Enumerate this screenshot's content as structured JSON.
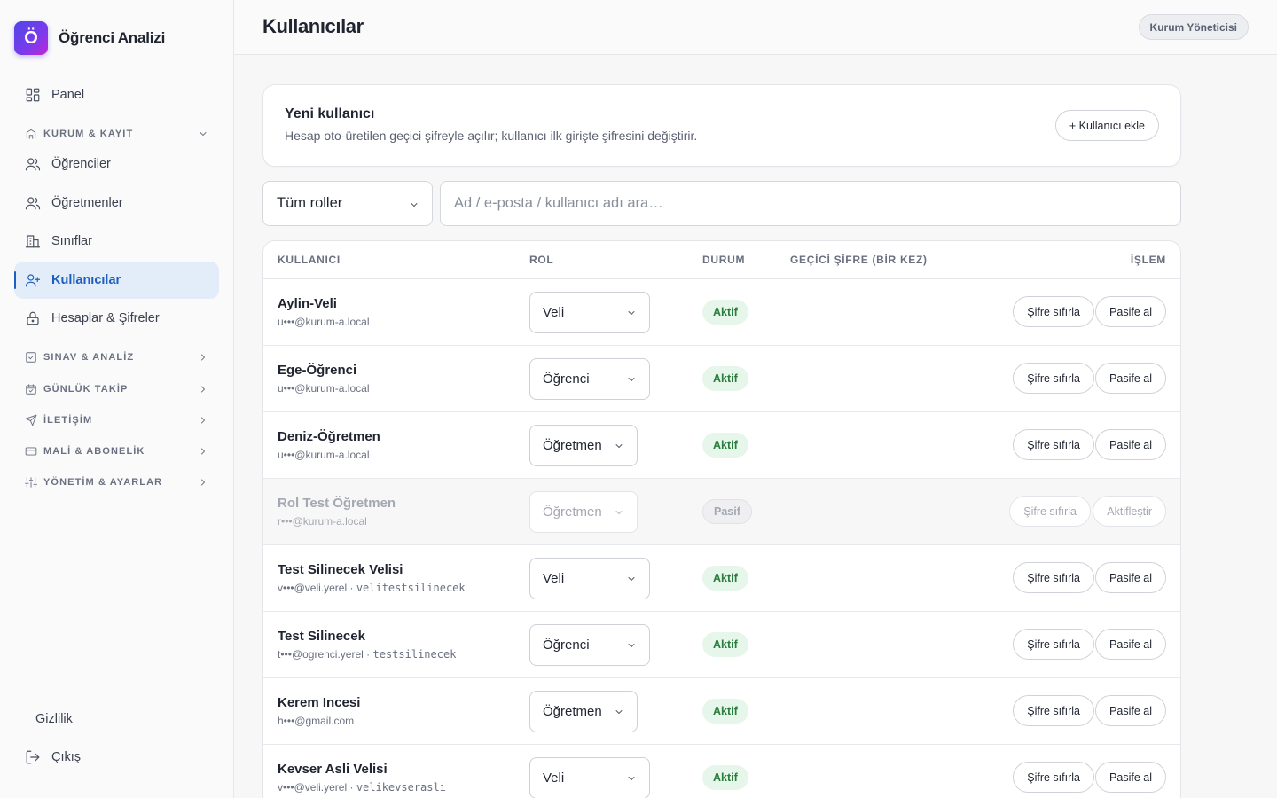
{
  "brand": {
    "logo_letter": "Ö",
    "title": "Öğrenci Analizi"
  },
  "sidebar": {
    "panel": "Panel",
    "groups": {
      "kurum": "KURUM & KAYIT",
      "sinav": "SINAV & ANALİZ",
      "gunluk": "GÜNLÜK TAKİP",
      "iletisim": "İLETİŞİM",
      "mali": "MALİ & ABONELİK",
      "yonetim": "YÖNETİM & AYARLAR"
    },
    "items": {
      "ogrenciler": "Öğrenciler",
      "ogretmenler": "Öğretmenler",
      "siniflar": "Sınıflar",
      "kullanicilar": "Kullanıcılar",
      "hesaplar": "Hesaplar & Şifreler"
    },
    "privacy": "Gizlilik",
    "logout": "Çıkış"
  },
  "header": {
    "title": "Kullanıcılar",
    "role_badge": "Kurum Yöneticisi"
  },
  "new_user": {
    "title": "Yeni kullanıcı",
    "subtitle": "Hesap oto-üretilen geçici şifreyle açılır; kullanıcı ilk girişte şifresini değiştirir.",
    "add_button": "+ Kullanıcı ekle"
  },
  "filters": {
    "role_select": "Tüm roller",
    "search_placeholder": "Ad / e-posta / kullanıcı adı ara…"
  },
  "table": {
    "headers": {
      "user": "KULLANICI",
      "role": "ROL",
      "status": "DURUM",
      "temp_password": "GEÇİCİ ŞİFRE (BİR KEZ)",
      "action": "İŞLEM"
    },
    "rows": [
      {
        "name": "Aylin-Veli",
        "email": "u•••@kurum-a.local",
        "username": "",
        "role": "Veli",
        "status": "Aktif",
        "reset": "Şifre sıfırla",
        "toggle": "Pasife al"
      },
      {
        "name": "Ege-Öğrenci",
        "email": "u•••@kurum-a.local",
        "username": "",
        "role": "Öğrenci",
        "status": "Aktif",
        "reset": "Şifre sıfırla",
        "toggle": "Pasife al"
      },
      {
        "name": "Deniz-Öğretmen",
        "email": "u•••@kurum-a.local",
        "username": "",
        "role": "Öğretmen",
        "status": "Aktif",
        "reset": "Şifre sıfırla",
        "toggle": "Pasife al"
      },
      {
        "name": "Rol Test Öğretmen",
        "email": "r•••@kurum-a.local",
        "username": "",
        "role": "Öğretmen",
        "status": "Pasif",
        "reset": "Şifre sıfırla",
        "toggle": "Aktifleştir"
      },
      {
        "name": "Test Silinecek Velisi",
        "email": "v•••@veli.yerel",
        "separator": " · ",
        "username": "velitestsilinecek",
        "role": "Veli",
        "status": "Aktif",
        "reset": "Şifre sıfırla",
        "toggle": "Pasife al"
      },
      {
        "name": "Test Silinecek",
        "email": "t•••@ogrenci.yerel",
        "separator": " · ",
        "username": "testsilinecek",
        "role": "Öğrenci",
        "status": "Aktif",
        "reset": "Şifre sıfırla",
        "toggle": "Pasife al"
      },
      {
        "name": "Kerem Incesi",
        "email": "h•••@gmail.com",
        "username": "",
        "role": "Öğretmen",
        "status": "Aktif",
        "reset": "Şifre sıfırla",
        "toggle": "Pasife al"
      },
      {
        "name": "Kevser Asli Velisi",
        "email": "v•••@veli.yerel",
        "separator": " · ",
        "username": "velikevserasli",
        "role": "Veli",
        "status": "Aktif",
        "reset": "Şifre sıfırla",
        "toggle": "Pasife al"
      }
    ]
  }
}
